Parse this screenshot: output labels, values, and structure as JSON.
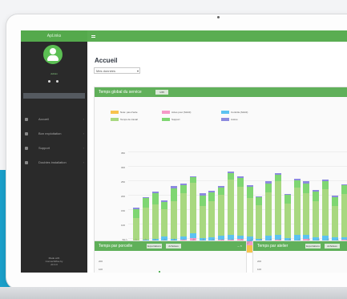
{
  "app": {
    "brand": "Apl.inks",
    "user": "Admin",
    "footer": [
      "Made with",
      "ConnectWise by",
      "Alt 3.0"
    ]
  },
  "navigation": [
    {
      "label": "Accueil",
      "icon": "home-icon"
    },
    {
      "label": "Bon exploitation",
      "icon": "chart-icon"
    },
    {
      "label": "Support",
      "icon": "support-icon"
    },
    {
      "label": "Doubles installation",
      "icon": "shield-icon"
    }
  ],
  "header": {
    "title": "Accueil"
  },
  "filter": {
    "selected": "Mes données"
  },
  "chart_data": {
    "type": "bar",
    "title": "Temps global du service",
    "pill": "1/45",
    "categories": [
      "2019-01",
      "2019-02",
      "2019-03",
      "2019-04",
      "2019-05",
      "2019-06",
      "2019-07",
      "2019-08",
      "2019-09",
      "2019-10",
      "2019-11",
      "2019-12",
      "2020-01",
      "2020-02",
      "2020-03",
      "2020-04",
      "2020-05",
      "2020-06",
      "2020-07",
      "2020-08",
      "2020-09",
      "2020-10",
      "2020-11",
      "2020-12"
    ],
    "ylim": [
      0,
      350
    ],
    "ticks": [
      0,
      50,
      100,
      150,
      200,
      250,
      300,
      350
    ],
    "grid": true,
    "legend_position": "top",
    "series": [
      {
        "name": "Note: pas d'acte",
        "color": "#f8c24d",
        "values": [
          20,
          25,
          18,
          30,
          24,
          32,
          35,
          22,
          28,
          30,
          34,
          30,
          25,
          26,
          28,
          33,
          20,
          30,
          35,
          24,
          26,
          20,
          28,
          24
        ]
      },
      {
        "name": "Actes pour (Mobil)",
        "color": "#f599c8",
        "values": [
          12,
          10,
          16,
          12,
          14,
          12,
          16,
          18,
          14,
          15,
          10,
          16,
          14,
          12,
          15,
          11,
          16,
          10,
          13,
          12,
          15,
          18,
          16,
          14
        ]
      },
      {
        "name": "Contrôle (Mobil)",
        "color": "#5cc2f1",
        "values": [
          8,
          10,
          12,
          14,
          10,
          12,
          15,
          10,
          12,
          14,
          18,
          12,
          16,
          10,
          15,
          18,
          14,
          20,
          13,
          16,
          18,
          14,
          10,
          12
        ]
      },
      {
        "name": "Temps de travail",
        "color": "#a8d880",
        "values": [
          80,
          110,
          120,
          95,
          130,
          150,
          175,
          110,
          125,
          140,
          190,
          170,
          135,
          115,
          150,
          185,
          120,
          165,
          145,
          125,
          160,
          110,
          150,
          140
        ]
      },
      {
        "name": "Support",
        "color": "#7fd672",
        "values": [
          30,
          35,
          40,
          24,
          44,
          28,
          20,
          38,
          30,
          26,
          24,
          30,
          38,
          28,
          32,
          22,
          30,
          25,
          34,
          35,
          28,
          30,
          28,
          26
        ]
      },
      {
        "name": "Autres",
        "color": "#8c8adf",
        "values": [
          5,
          3,
          4,
          6,
          8,
          5,
          4,
          7,
          5,
          6,
          4,
          5,
          6,
          4,
          7,
          5,
          4,
          6,
          8,
          4,
          6,
          5,
          4,
          6
        ]
      }
    ]
  },
  "bottom_left": {
    "title": "Temps par porcelle",
    "buttons": [
      "Exportations",
      "Achétées"
    ]
  },
  "bottom_right": {
    "title": "Temps par atelier",
    "buttons": [
      "Exportations",
      "Achétées"
    ]
  }
}
